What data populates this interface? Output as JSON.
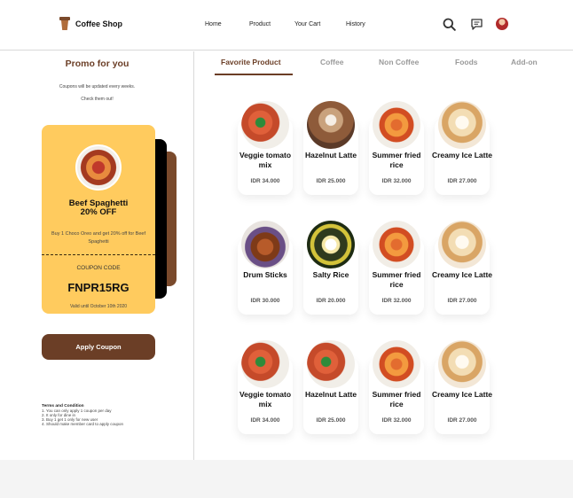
{
  "header": {
    "brand": "Coffee Shop",
    "nav": [
      "Home",
      "Product",
      "Your Cart",
      "History"
    ],
    "icons": [
      "search-icon",
      "chat-icon",
      "avatar"
    ]
  },
  "promo": {
    "title": "Promo for you",
    "subtitle_line1": "Coupons will be updated every weeks.",
    "subtitle_line2": "Check them out!",
    "coupon": {
      "name": "Beef Spaghetti",
      "discount": "20% OFF",
      "description": "Buy 1 Choco Oreo and get 20% off for Beef Spaghetti",
      "code_label": "COUPON CODE",
      "code": "FNPR15RG",
      "valid_until": "Valid until October 10th 2020"
    },
    "apply_label": "Apply Coupon",
    "terms": {
      "title": "Terms and Condition",
      "items": [
        "1. You can only apply 1 coupon per day",
        "2. It only for dine in",
        "3. Buy 1 get 1 only for new user",
        "4. Should make member card to apply coupon"
      ]
    }
  },
  "tabs": [
    "Favorite Product",
    "Coffee",
    "Non Coffee",
    "Foods",
    "Add-on"
  ],
  "active_tab": "Favorite Product",
  "products": [
    {
      "name": "Veggie tomato mix",
      "price": "IDR 34.000"
    },
    {
      "name": "Hazelnut Latte",
      "price": "IDR 25.000"
    },
    {
      "name": "Summer fried rice",
      "price": "IDR 32.000"
    },
    {
      "name": "Creamy Ice Latte",
      "price": "IDR 27.000"
    },
    {
      "name": "Drum Sticks",
      "price": "IDR 30.000"
    },
    {
      "name": "Salty Rice",
      "price": "IDR 20.000"
    },
    {
      "name": "Summer fried rice",
      "price": "IDR 32.000"
    },
    {
      "name": "Creamy Ice Latte",
      "price": "IDR 27.000"
    },
    {
      "name": "Veggie tomato mix",
      "price": "IDR 34.000"
    },
    {
      "name": "Hazelnut Latte",
      "price": "IDR 25.000"
    },
    {
      "name": "Summer fried rice",
      "price": "IDR 32.000"
    },
    {
      "name": "Creamy Ice Latte",
      "price": "IDR 27.000"
    }
  ],
  "colors": {
    "brand_brown": "#6b3e26",
    "coupon_yellow": "#ffcb5e",
    "tab_inactive": "#9a9a9a"
  }
}
